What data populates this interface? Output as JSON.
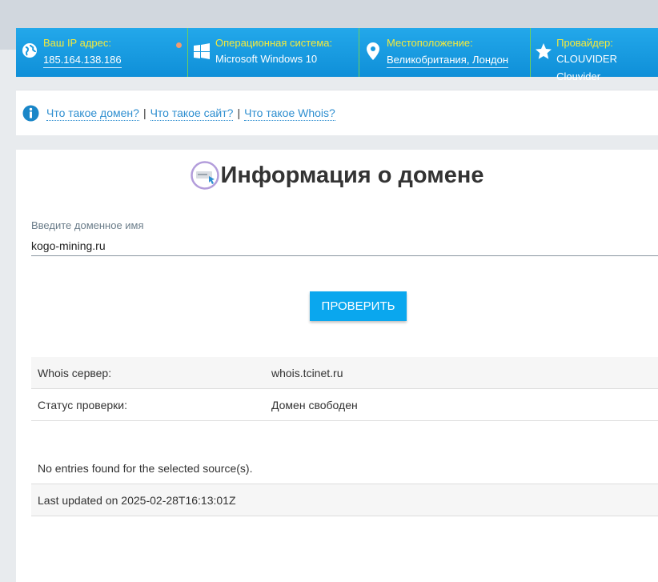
{
  "infobar": {
    "ip": {
      "label": "Ваш IP адрес:",
      "value": "185.164.138.186",
      "icon": "globe-icon"
    },
    "os": {
      "label": "Операционная система:",
      "value": "Microsoft Windows 10",
      "icon": "windows-icon"
    },
    "location": {
      "label": "Местоположение:",
      "value": "Великобритания, Лондон",
      "icon": "map-pin-icon"
    },
    "provider": {
      "label": "Провайдер:",
      "value": "CLOUVIDER Clouvider",
      "icon": "star-icon"
    },
    "colors": {
      "label": "#f6ea3a",
      "bar": "#1a9be0",
      "divider": "#6fcf5a"
    }
  },
  "faq": {
    "links": [
      "Что такое домен?",
      "Что такое сайт?",
      "Что такое Whois?"
    ],
    "separator": "|"
  },
  "form": {
    "title": "Информация о домене",
    "field_label": "Введите доменное имя",
    "domain_value": "kogo-mining.ru",
    "button_label": "ПРОВЕРИТЬ"
  },
  "results": {
    "rows": [
      {
        "key": "Whois сервер:",
        "value": "whois.tcinet.ru"
      },
      {
        "key": "Статус проверки:",
        "value": "Домен свободен"
      }
    ],
    "raw_lines": [
      "No entries found for the selected source(s).",
      "Last updated on 2025-02-28T16:13:01Z"
    ]
  }
}
